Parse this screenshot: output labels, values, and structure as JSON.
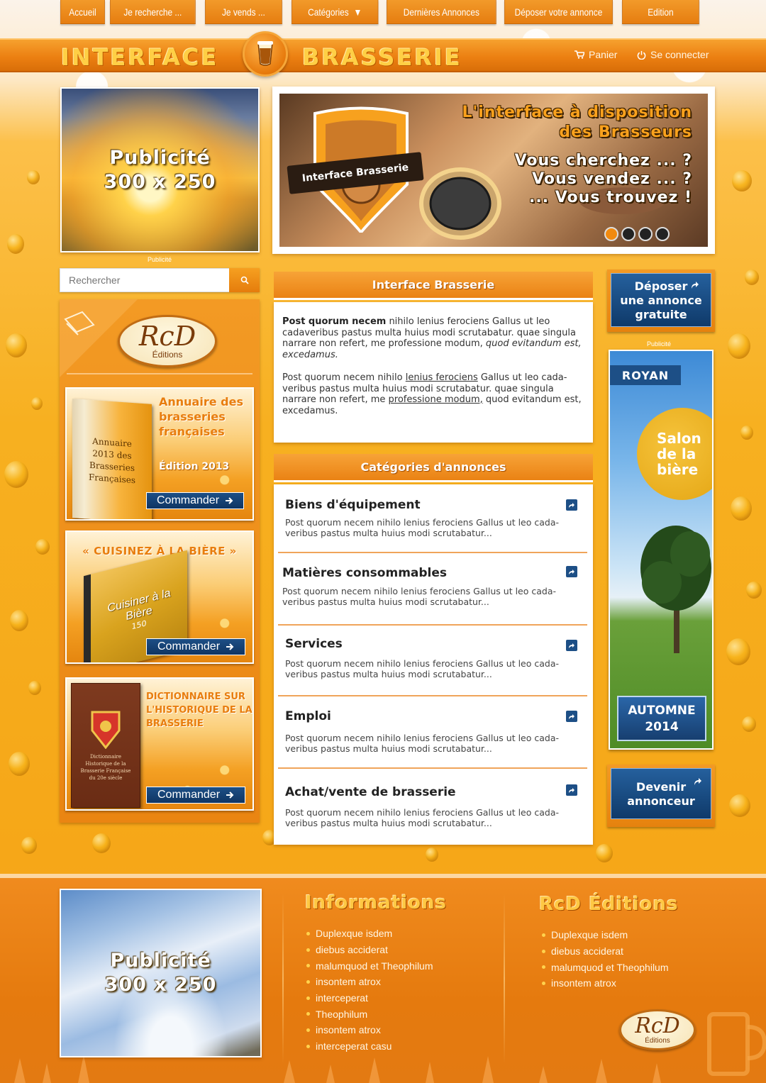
{
  "nav": {
    "items": [
      {
        "label": "Accueil"
      },
      {
        "label": "Je recherche ..."
      },
      {
        "label": "Je vends ..."
      },
      {
        "label": "Catégories"
      },
      {
        "label": "Dernières Annonces"
      },
      {
        "label": "Déposer votre annonce"
      },
      {
        "label": "Edition"
      }
    ],
    "categories_arrow": "▼"
  },
  "header": {
    "brand_left": "INTERFACE",
    "brand_right": "BRASSERIE",
    "cart_label": "Panier",
    "login_label": "Se connecter"
  },
  "ads": {
    "top_left": {
      "line1": "Publicité",
      "line2": "300 x 250",
      "caption": "Publicité"
    },
    "right_caption": "Publicité",
    "footer": {
      "line1": "Publicité",
      "line2": "300 x 250"
    }
  },
  "slider": {
    "line1": "L'interface à disposition",
    "line2": "des Brasseurs",
    "line3": "Vous cherchez ... ?",
    "line4": "Vous vendez ... ?",
    "line5": "... Vous trouvez !",
    "badge": "Interface Brasserie",
    "dots_count": 4,
    "active_dot": 0
  },
  "search": {
    "placeholder": "Rechercher"
  },
  "rcd": {
    "main": "RcD",
    "sub": "Éditions"
  },
  "books": [
    {
      "title": "Annuaire des brasseries françaises",
      "subtitle": "Édition 2013",
      "cover_text": "Annuaire 2013 des Brasseries Françaises",
      "button": "Commander"
    },
    {
      "title": "« CUISINEZ À LA BIÈRE »",
      "cover_text": "Cuisiner à la Bière",
      "cover_sub": "150",
      "button": "Commander"
    },
    {
      "title": "DICTIONNAIRE SUR L'HISTORIQUE DE LA BRASSERIE",
      "cover_text": "Dictionnaire Historique de la Brasserie Française du 20e siècle",
      "button": "Commander"
    }
  ],
  "intro": {
    "title": "Interface Brasserie",
    "p1_bold": "Post quorum necem",
    "p1_text": " nihilo lenius ferociens Gallus ut leo cadaveribus pastus multa huius modi scrutabatur. quae singula narrare non refert, me professione modum, ",
    "p1_italic": "quod evitandum est, excedamus.",
    "p2_a": "Post quorum necem nihilo ",
    "p2_link1": "lenius ferociens",
    "p2_b": " Gallus ut leo cada-veribus pastus multa huius modi scrutabatur. quae singula narrare non refert, me ",
    "p2_link2": "professione modum,",
    "p2_c": " quod evitandum est, excedamus."
  },
  "categories": {
    "title": "Catégories d'annonces",
    "items": [
      {
        "title": "Biens d'équipement",
        "desc": "Post quorum necem nihilo lenius ferociens Gallus ut leo cada-veribus pastus multa huius modi scrutabatur..."
      },
      {
        "title": "Matières consommables",
        "desc": "Post quorum necem nihilo lenius ferociens Gallus ut leo cada-veribus pastus multa huius modi scrutabatur..."
      },
      {
        "title": "Services",
        "desc": "Post quorum necem nihilo lenius ferociens Gallus ut leo cada-veribus pastus multa huius modi scrutabatur..."
      },
      {
        "title": "Emploi",
        "desc": "Post quorum necem nihilo lenius ferociens Gallus ut leo cada-veribus pastus multa huius modi scrutabatur..."
      },
      {
        "title": "Achat/vente de brasserie",
        "desc": "Post quorum necem nihilo lenius ferociens Gallus ut leo cada-veribus pastus multa huius modi scrutabatur..."
      }
    ]
  },
  "right": {
    "deposit": {
      "line1": "Déposer",
      "line2": "une annonce",
      "line3": "gratuite"
    },
    "salon": {
      "city": "ROYAN",
      "line1": "Salon",
      "line2": "de la",
      "line3": "bière",
      "season": "AUTOMNE",
      "year": "2014"
    },
    "advertiser": {
      "line1": "Devenir",
      "line2": "annonceur"
    }
  },
  "footer": {
    "info_title": "Informations",
    "info_items": [
      "Duplexque isdem",
      "diebus acciderat",
      "malumquod et Theophilum",
      "insontem atrox",
      "interceperat",
      "Theophilum",
      "insontem atrox",
      "interceperat casu"
    ],
    "rcd_title": "RcD Éditions",
    "rcd_items": [
      "Duplexque isdem",
      "diebus acciderat",
      "malumquod et Theophilum",
      "insontem atrox"
    ],
    "rcd_logo_main": "RcD",
    "rcd_logo_sub": "Éditions"
  },
  "colors": {
    "orange": "#ec8012",
    "gold": "#ffcf45",
    "blue": "#1d4f86"
  }
}
